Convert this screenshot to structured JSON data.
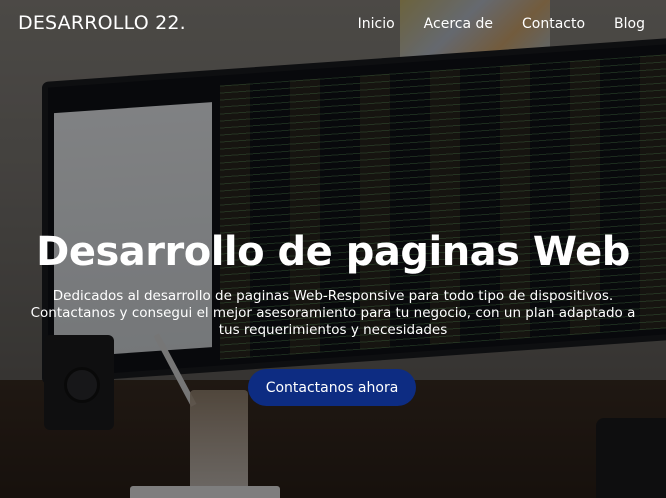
{
  "navbar": {
    "brand": "DESARROLLO 22.",
    "links": [
      {
        "label": "Inicio"
      },
      {
        "label": "Acerca de"
      },
      {
        "label": "Contacto"
      },
      {
        "label": "Blog"
      }
    ]
  },
  "hero": {
    "title": "Desarrollo de paginas Web",
    "description": "Dedicados al desarrollo de paginas Web-Responsive para todo tipo de dispositivos. Contactanos y consegui el mejor asesoramiento para tu negocio, con un plan adaptado a tus requerimientos y necesidades",
    "cta_label": "Contactanos ahora"
  },
  "colors": {
    "cta_background": "#0d2c82",
    "text": "#ffffff"
  }
}
